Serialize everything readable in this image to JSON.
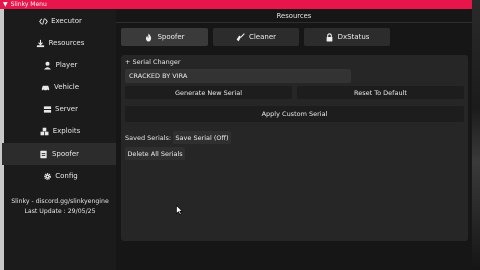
{
  "window": {
    "title": "Slinky Menu",
    "accent": "#e8154a"
  },
  "sidebar": {
    "items": [
      {
        "label": "Executor",
        "icon": "code-icon"
      },
      {
        "label": "Resources",
        "icon": "download-icon"
      },
      {
        "label": "Player",
        "icon": "user-icon"
      },
      {
        "label": "Vehicle",
        "icon": "car-icon"
      },
      {
        "label": "Server",
        "icon": "server-icon"
      },
      {
        "label": "Exploits",
        "icon": "cubes-icon"
      },
      {
        "label": "Spoofer",
        "icon": "id-card-icon"
      },
      {
        "label": "Config",
        "icon": "gear-icon"
      }
    ],
    "active": "Spoofer",
    "footer_line1": "Slinky - discord.gg/slinkyengine",
    "footer_line2": "Last Update : 29/05/25"
  },
  "main": {
    "title": "Resources",
    "tabs": [
      {
        "label": "Spoofer",
        "icon": "fire-icon"
      },
      {
        "label": "Cleaner",
        "icon": "broom-icon"
      },
      {
        "label": "DxStatus",
        "icon": "lock-icon"
      }
    ],
    "active_tab": "Spoofer"
  },
  "serial_changer": {
    "section_label": "+ Serial Changer",
    "current_serial": "CRACKED BY VIRA",
    "generate_label": "Generate New Serial",
    "reset_label": "Reset To Default",
    "apply_label": "Apply Custom Serial",
    "saved_label": "Saved Serials:",
    "save_label": "Save Serial (Off)",
    "delete_label": "Delete All Serials"
  }
}
